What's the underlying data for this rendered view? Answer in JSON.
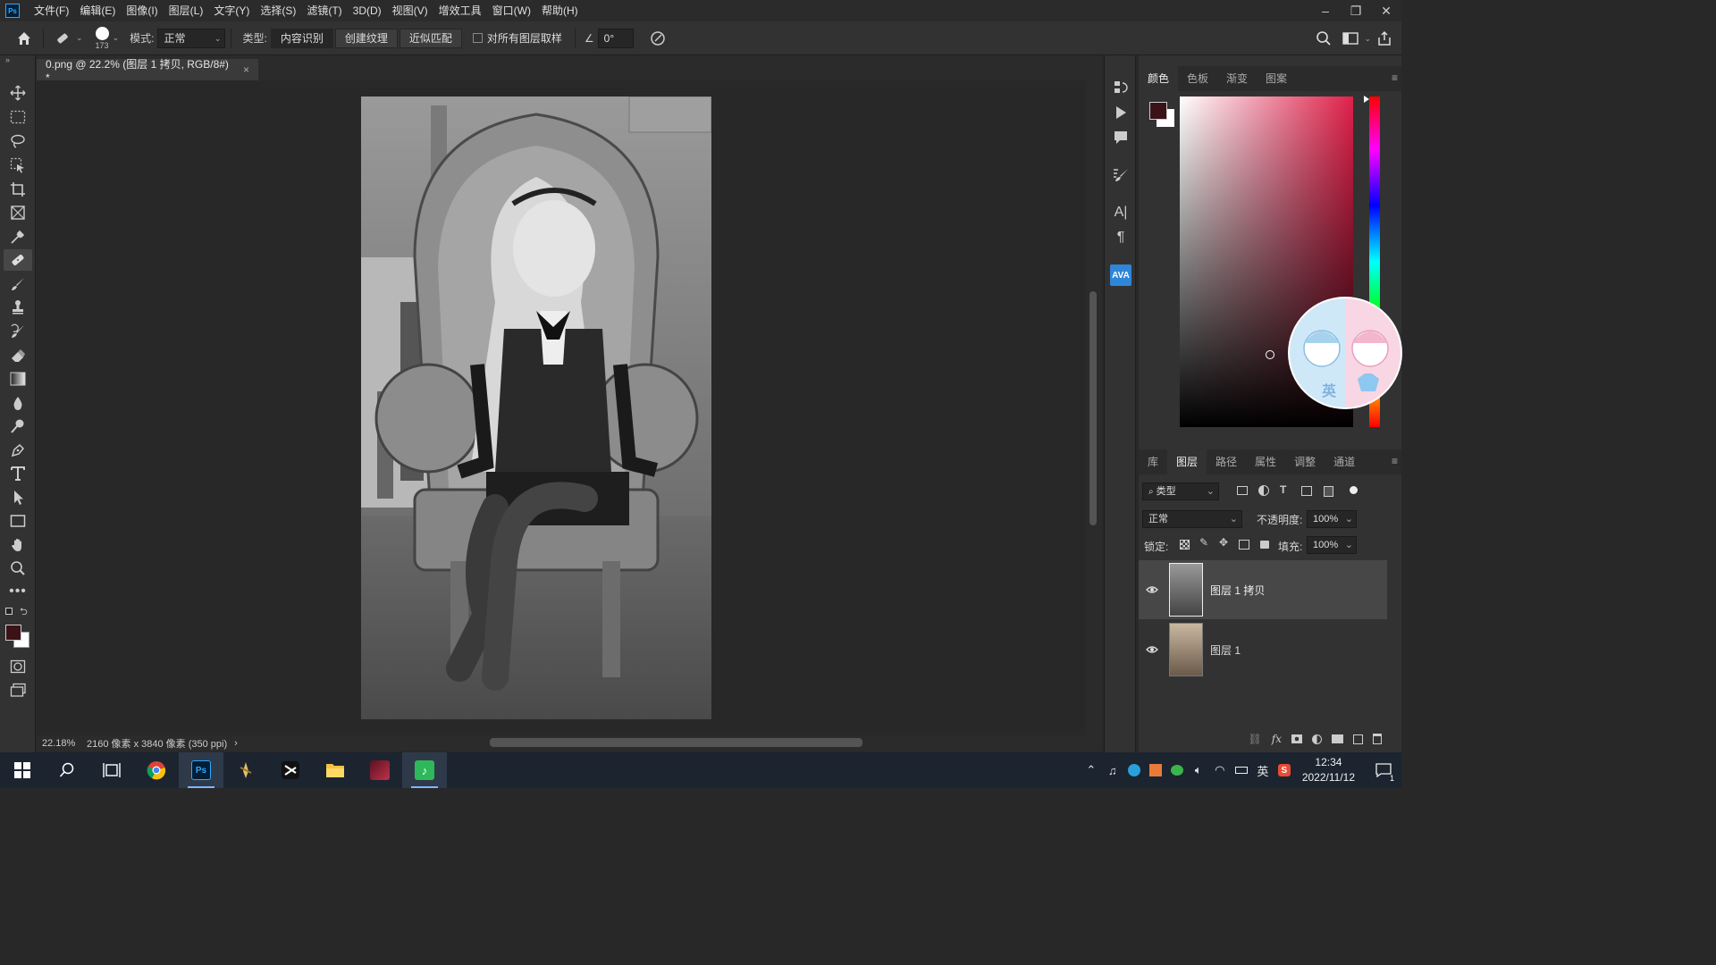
{
  "app": {
    "logo": "Ps"
  },
  "menubar": {
    "items": [
      "文件(F)",
      "编辑(E)",
      "图像(I)",
      "图层(L)",
      "文字(Y)",
      "选择(S)",
      "滤镜(T)",
      "3D(D)",
      "视图(V)",
      "增效工具",
      "窗口(W)",
      "帮助(H)"
    ],
    "window_controls": {
      "minimize": "–",
      "restore": "❐",
      "close": "✕"
    }
  },
  "options": {
    "brush_size": "173",
    "mode_label": "模式:",
    "mode_value": "正常",
    "type_label": "类型:",
    "type_buttons": [
      "内容识别",
      "创建纹理",
      "近似匹配"
    ],
    "sample_all_label": "对所有图层取样",
    "angle_value": "0°"
  },
  "document": {
    "tab_title": "0.png @ 22.2% (图层 1 拷贝, RGB/8#) *",
    "tab_close": "×",
    "zoom": "22.18%",
    "doc_info": "2160 像素 x 3840 像素 (350 ppi)",
    "status_arrow": "›"
  },
  "panels": {
    "color_tabs": [
      "颜色",
      "色板",
      "渐变",
      "图案"
    ],
    "foreground_color": "#3b1217",
    "background_color": "#ffffff",
    "sticker_text": "英",
    "layer_tabs": [
      "库",
      "图层",
      "路径",
      "属性",
      "调整",
      "通道"
    ],
    "filter_kind": "类型",
    "blend_mode": "正常",
    "opacity_label": "不透明度:",
    "opacity_value": "100%",
    "lock_label": "锁定:",
    "fill_label": "填充:",
    "fill_value": "100%",
    "layers": [
      {
        "name": "图层 1 拷贝",
        "visible": true,
        "selected": true
      },
      {
        "name": "图层 1",
        "visible": true,
        "selected": false
      }
    ]
  },
  "middock": {
    "ava_label": "AVA"
  },
  "taskbar": {
    "ime": "英",
    "time": "12:34",
    "date": "2022/11/12",
    "notification_count": "1"
  }
}
